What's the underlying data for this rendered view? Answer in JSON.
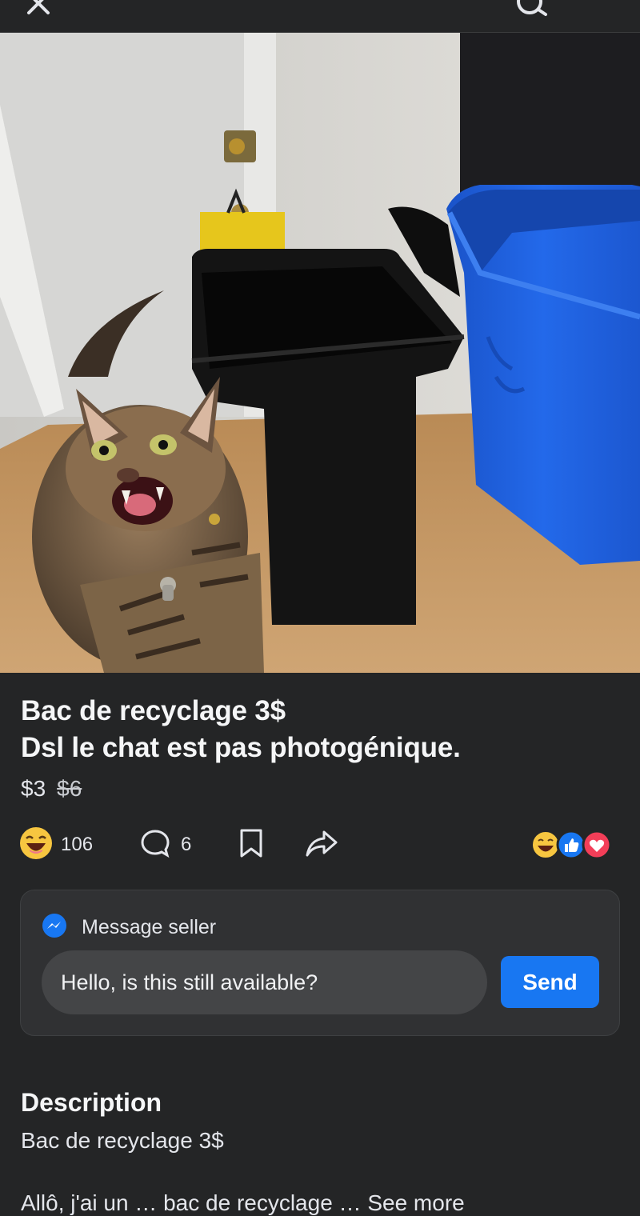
{
  "icons": {
    "close": "close-icon",
    "search": "search-icon",
    "laugh": "laughing-emoji-icon",
    "comment": "comment-icon",
    "save": "bookmark-icon",
    "share": "share-icon",
    "messenger": "messenger-icon",
    "like": "like-reaction-icon",
    "love": "love-reaction-icon"
  },
  "colors": {
    "background": "#242526",
    "card": "#303133",
    "input": "#444547",
    "accent": "#1877f2",
    "recycling_bin": "#1f5fd6"
  },
  "listing": {
    "title_line1": "Bac de recyclage 3$",
    "title_line2": "Dsl le chat est pas photogénique.",
    "price": "$3",
    "original_price": "$6"
  },
  "engagement": {
    "reaction_count": "106",
    "comment_count": "6"
  },
  "message": {
    "header": "Message seller",
    "input_value": "Hello, is this still available?",
    "send_label": "Send"
  },
  "description": {
    "heading": "Description",
    "line1": "Bac de recyclage 3$",
    "line2_partial": "Allô, j'ai un … bac de recyclage … See more"
  }
}
